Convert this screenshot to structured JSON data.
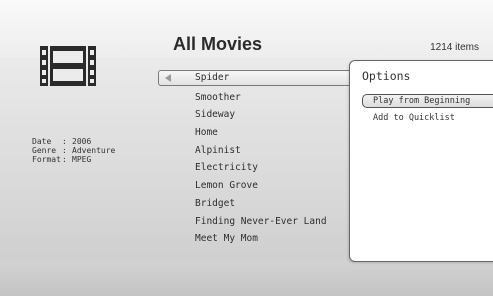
{
  "header": {
    "title": "All Movies",
    "item_count": "1214 items"
  },
  "details": {
    "date_key": "Date",
    "date_value": "2006",
    "genre_key": "Genre",
    "genre_value": "Adventure",
    "format_key": "Format",
    "format_value": "MPEG",
    "separator": ":"
  },
  "movie_list": {
    "items": [
      "Spider",
      "Smoother",
      "Sideway",
      "Home",
      "Alpinist",
      "Electricity",
      "Lemon Grove",
      "Bridget",
      "Finding Never-Ever Land",
      "Meet My Mom"
    ],
    "selected_index": 0
  },
  "options_menu": {
    "title": "Options",
    "items": [
      "Play from Beginning",
      "Add to Quicklist"
    ],
    "highlighted_index": 0
  },
  "icons": {
    "film": "film-strip-icon",
    "back_arrow": "left-arrow-icon"
  }
}
